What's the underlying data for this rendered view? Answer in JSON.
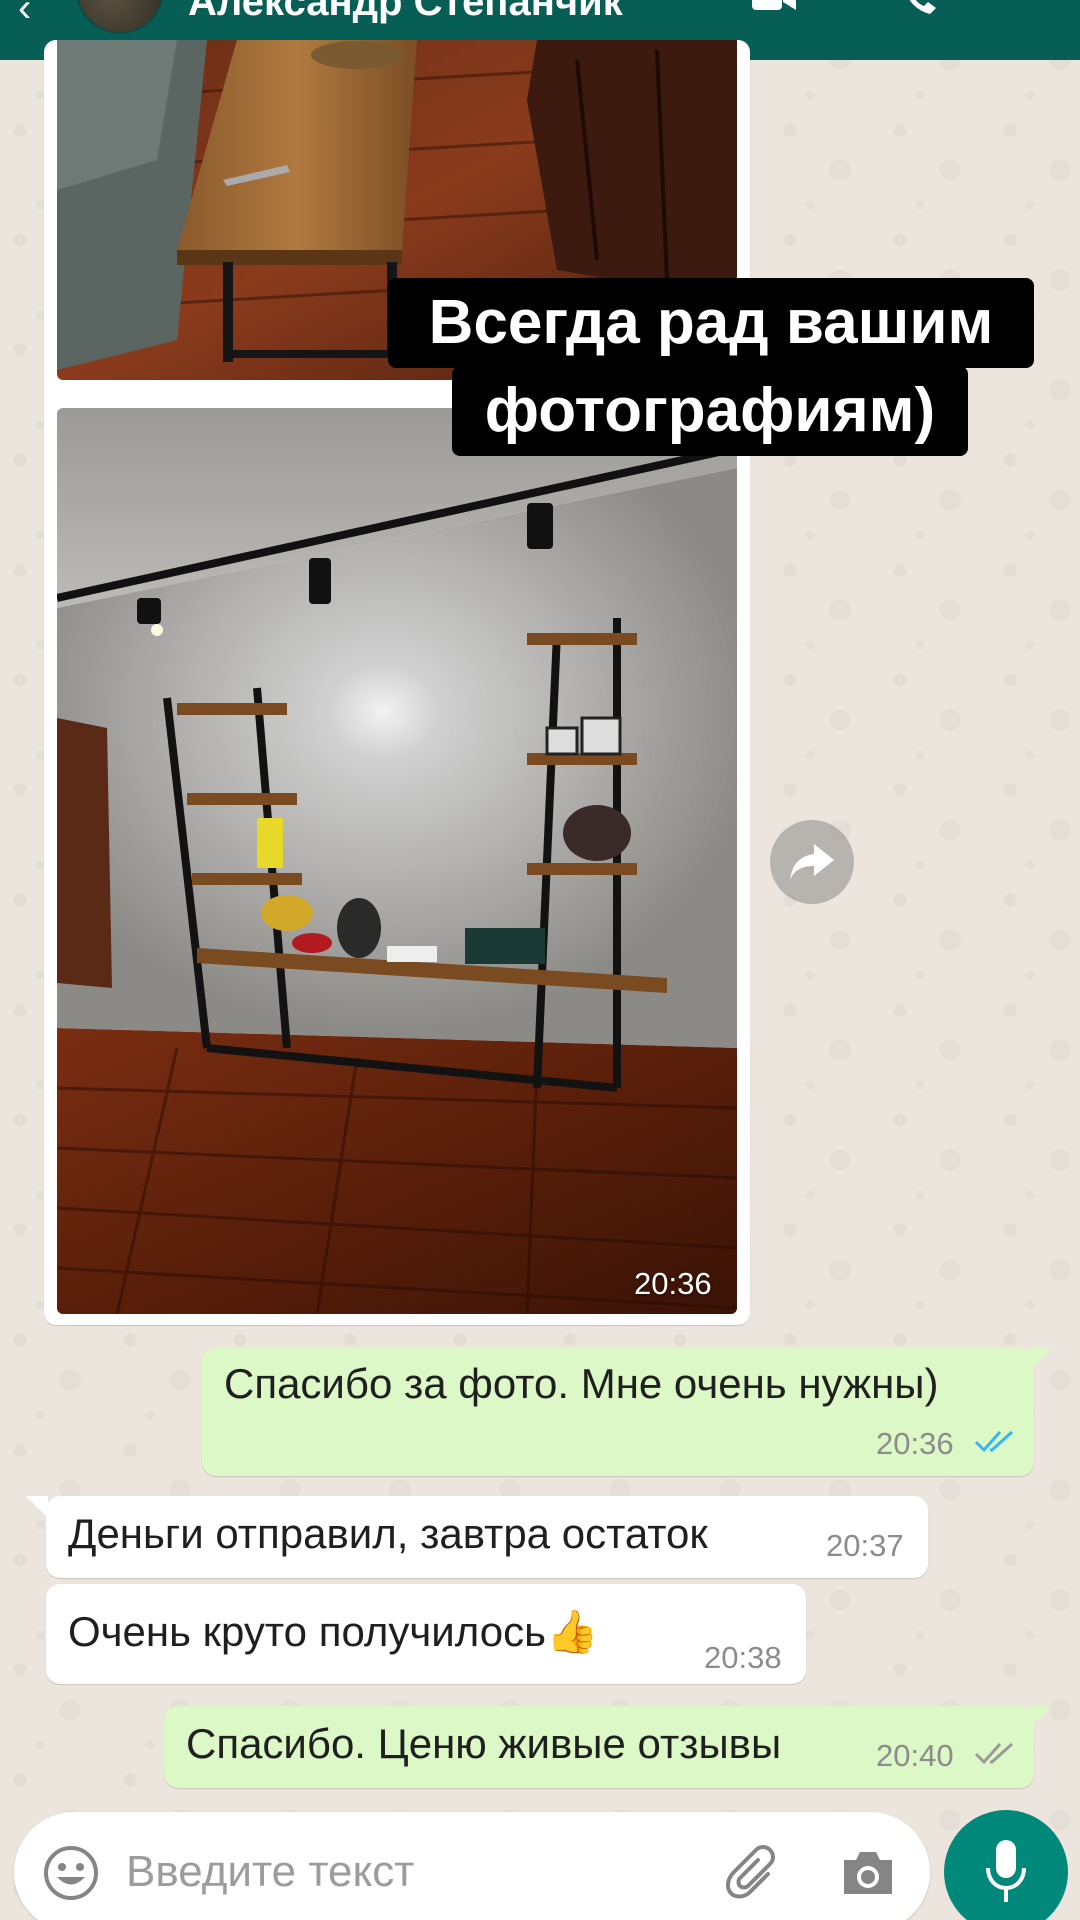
{
  "header": {
    "contact_name": "Александр Степанчик",
    "back_icon": "arrow-left-icon",
    "video_icon": "video-call-icon",
    "call_icon": "phone-call-icon",
    "menu_icon": "more-vert-icon",
    "color": "#075e54"
  },
  "image_message": {
    "caption_line1": "Всегда рад вашим",
    "caption_line2": "фотографиям)",
    "time": "20:36",
    "forward_icon": "forward-icon"
  },
  "messages": [
    {
      "direction": "out",
      "text": "Спасибо за фото. Мне очень нужны)",
      "time": "20:36",
      "status": "read"
    },
    {
      "direction": "in",
      "text": "Деньги отправил, завтра остаток",
      "time": "20:37"
    },
    {
      "direction": "in",
      "text": "Очень круто получилось👍",
      "time": "20:38"
    },
    {
      "direction": "out",
      "text": "Спасибо. Ценю живые отзывы",
      "time": "20:40",
      "status": "delivered"
    }
  ],
  "composer": {
    "placeholder": "Введите текст",
    "emoji_icon": "emoji-icon",
    "attach_icon": "paperclip-icon",
    "camera_icon": "camera-icon",
    "mic_icon": "microphone-icon"
  },
  "colors": {
    "incoming_bubble": "#ffffff",
    "outgoing_bubble": "#dcf8c6",
    "read_tick": "#34b7f1",
    "accent": "#00897b",
    "wallpaper": "#ece5dd"
  }
}
